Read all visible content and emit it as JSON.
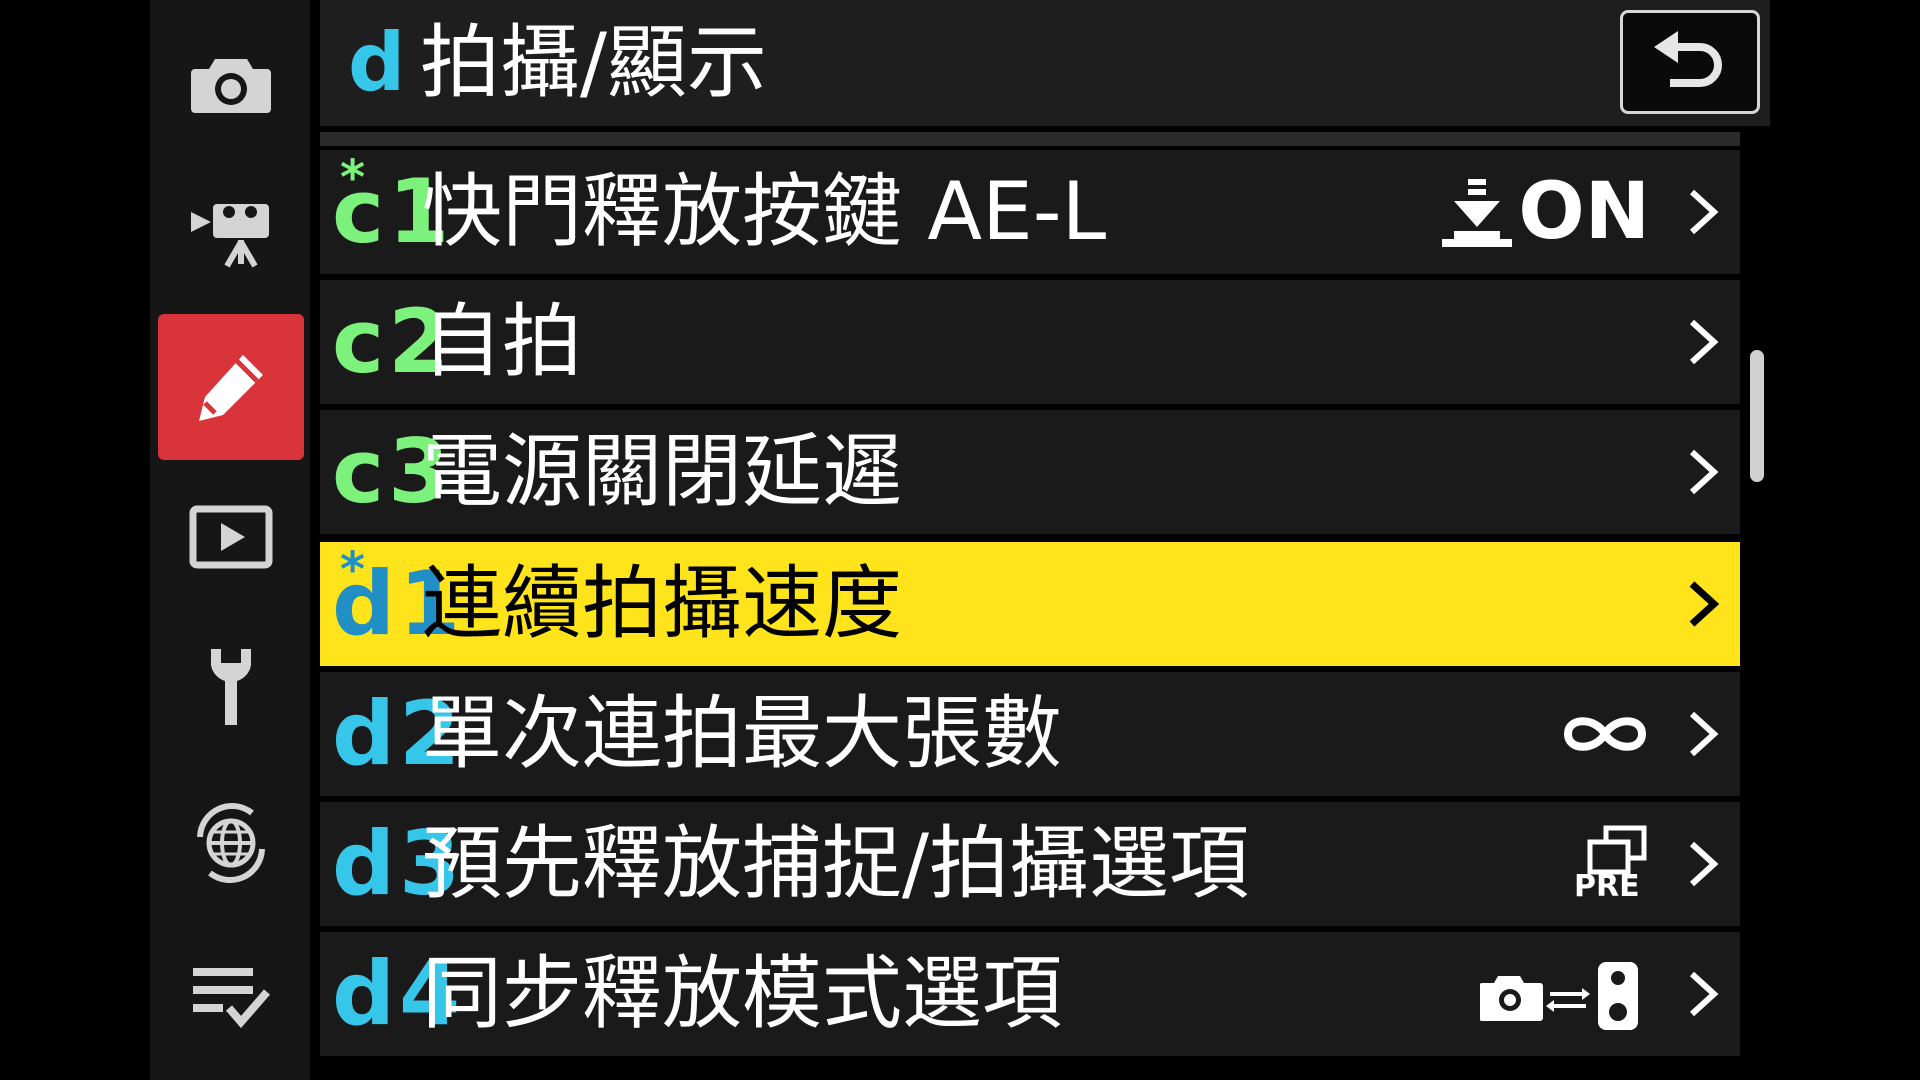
{
  "header": {
    "group_letter": "d",
    "title": "拍攝/顯示"
  },
  "rail": {
    "items": [
      {
        "icon": "camera-icon",
        "active": false
      },
      {
        "icon": "movie-camera-icon",
        "active": false
      },
      {
        "icon": "pencil-icon",
        "active": true
      },
      {
        "icon": "playback-icon",
        "active": false
      },
      {
        "icon": "wrench-icon",
        "active": false
      },
      {
        "icon": "network-icon",
        "active": false
      },
      {
        "icon": "my-menu-icon",
        "active": false
      }
    ]
  },
  "rows": [
    {
      "letter": "c",
      "num": "1",
      "asterisk": "*",
      "label": "快門釋放按鍵 AE-L",
      "value_text": "ON",
      "value_icon": "shutter-half-press-icon",
      "group": "c",
      "selected": false
    },
    {
      "letter": "c",
      "num": "2",
      "label": "自拍",
      "group": "c",
      "selected": false
    },
    {
      "letter": "c",
      "num": "3",
      "label": "電源關閉延遲",
      "group": "c",
      "selected": false
    },
    {
      "letter": "d",
      "num": "1",
      "asterisk": "*",
      "label": "連續拍攝速度",
      "group": "d",
      "selected": true
    },
    {
      "letter": "d",
      "num": "2",
      "label": "單次連拍最大張數",
      "value_icon": "infinity-icon",
      "group": "d",
      "selected": false
    },
    {
      "letter": "d",
      "num": "3",
      "label": "預先釋放捕捉/拍攝選項",
      "value_icon": "pre-capture-icon",
      "value_icon_text": "PRE",
      "group": "d",
      "selected": false
    },
    {
      "letter": "d",
      "num": "4",
      "label": "同步釋放模式選項",
      "value_icon": "camera-sync-remote-icon",
      "group": "d",
      "selected": false
    }
  ],
  "colors": {
    "selected_bg": "#ffe41c",
    "active_rail": "#d8343a",
    "group_c": "#7cf27c",
    "group_d": "#35c6ea"
  }
}
